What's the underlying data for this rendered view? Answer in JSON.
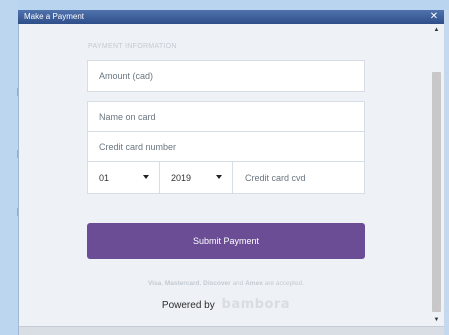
{
  "window": {
    "title": "Make a Payment",
    "close_glyph": "✕"
  },
  "form": {
    "section_title": "PAYMENT INFORMATION",
    "amount_placeholder": "Amount (cad)",
    "name_placeholder": "Name on card",
    "card_placeholder": "Credit card number",
    "month_value": "01",
    "year_value": "2019",
    "cvd_placeholder": "Credit card cvd",
    "submit_label": "Submit Payment"
  },
  "footer": {
    "brands": [
      "Visa",
      "Mastercard",
      "Discover",
      "Amex"
    ],
    "and_text": "and",
    "accepted_text": "are accepted.",
    "powered_by": "Powered by",
    "brand": "bambora"
  },
  "colors": {
    "accent": "#6b4d96",
    "titlebar": "#3a5c9a"
  },
  "scrollbar": {
    "up_glyph": "▲",
    "down_glyph": "▼"
  }
}
